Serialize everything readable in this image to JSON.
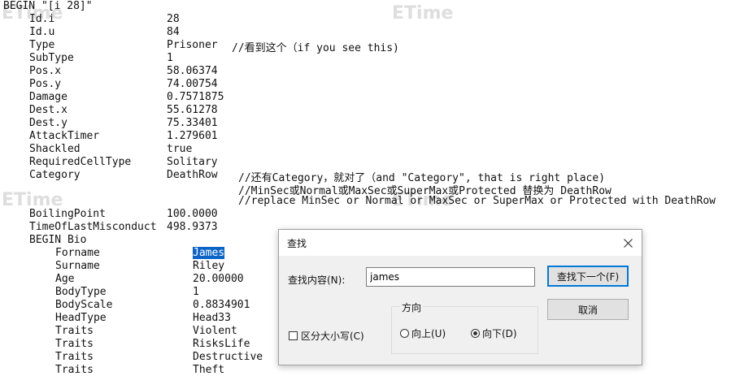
{
  "editor": {
    "begin_line": "BEGIN \"[i 28]\"",
    "rows": [
      {
        "k": "Id.i",
        "v": "28",
        "c": ""
      },
      {
        "k": "Id.u",
        "v": "84",
        "c": ""
      },
      {
        "k": "Type",
        "v": "Prisoner",
        "c": "//看到这个（if you see this)"
      },
      {
        "k": "SubType",
        "v": "1",
        "c": ""
      },
      {
        "k": "Pos.x",
        "v": "58.06374",
        "c": ""
      },
      {
        "k": "Pos.y",
        "v": "74.00754",
        "c": ""
      },
      {
        "k": "Damage",
        "v": "0.7571875",
        "c": ""
      },
      {
        "k": "Dest.x",
        "v": "55.61278",
        "c": ""
      },
      {
        "k": "Dest.y",
        "v": "75.33401",
        "c": ""
      },
      {
        "k": "AttackTimer",
        "v": "1.279601",
        "c": ""
      },
      {
        "k": "Shackled",
        "v": "true",
        "c": ""
      },
      {
        "k": "RequiredCellType",
        "v": "Solitary",
        "c": ""
      },
      {
        "k": "Category",
        "v": "DeathRow",
        "c": "//还有Category，就对了（and \"Category\", that is right place)"
      }
    ],
    "comment_line2": "//MinSec或Normal或MaxSec或SuperMax或Protected 替换为 DeathRow",
    "comment_line3": "//replace MinSec or Normal or MaxSec or SuperMax or Protected with DeathRow",
    "rows2": [
      {
        "k": "BoilingPoint",
        "v": "100.0000"
      },
      {
        "k": "TimeOfLastMisconduct",
        "v": "498.9373"
      }
    ],
    "begin_bio": "BEGIN Bio",
    "bio_rows": [
      {
        "k": "Forname",
        "v": "James"
      },
      {
        "k": "Surname",
        "v": "Riley"
      },
      {
        "k": "Age",
        "v": "20.00000"
      },
      {
        "k": "BodyType",
        "v": "1"
      },
      {
        "k": "BodyScale",
        "v": "0.8834901"
      },
      {
        "k": "HeadType",
        "v": "Head33"
      },
      {
        "k": "Traits",
        "v": "Violent"
      },
      {
        "k": "Traits",
        "v": "RisksLife"
      },
      {
        "k": "Traits",
        "v": "Destructive"
      },
      {
        "k": "Traits",
        "v": "Theft"
      }
    ]
  },
  "watermark": "ETime",
  "find_dialog": {
    "title": "查找",
    "find_label": "查找内容(N):",
    "find_value": "james",
    "find_next_label": "查找下一个(F)",
    "cancel_label": "取消",
    "direction_label": "方向",
    "up_label": "向上(U)",
    "down_label": "向下(D)",
    "match_case_label": "区分大小写(C)",
    "selected_direction": "down"
  },
  "colors": {
    "selection": "#0a64c8",
    "default_button_border": "#0078d7"
  }
}
